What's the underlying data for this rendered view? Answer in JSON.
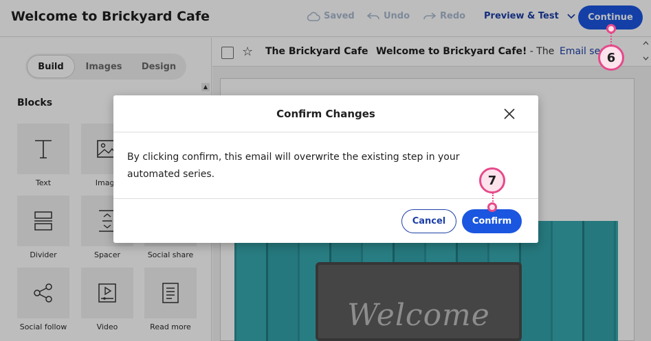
{
  "app": {
    "title": "Welcome to Brickyard Cafe"
  },
  "toolbar": {
    "saved_label": "Saved",
    "undo_label": "Undo",
    "redo_label": "Redo",
    "preview_label": "Preview & Test",
    "continue_label": "Continue",
    "accent": "#1a56e0"
  },
  "left_panel": {
    "tabs": [
      {
        "label": "Build",
        "active": true
      },
      {
        "label": "Images",
        "active": false
      },
      {
        "label": "Design",
        "active": false
      }
    ],
    "blocks_heading": "Blocks",
    "blocks": [
      {
        "label": "Text",
        "icon": "text-icon"
      },
      {
        "label": "Image",
        "icon": "image-icon"
      },
      {
        "label": "Divider",
        "icon": "divider-icon"
      },
      {
        "label": "Spacer",
        "icon": "spacer-icon"
      },
      {
        "label": "Social share",
        "icon": "social-share-icon"
      },
      {
        "label": "Social follow",
        "icon": "social-follow-icon"
      },
      {
        "label": "Video",
        "icon": "video-icon"
      },
      {
        "label": "Read more",
        "icon": "read-more-icon"
      }
    ]
  },
  "email_header": {
    "sender": "The Brickyard Cafe",
    "subject": "Welcome to Brickyard Cafe!",
    "preview": " - The Brickyard Cafe",
    "series_link": "Email series"
  },
  "email_body": {
    "sign_text": "Welcome"
  },
  "dialog": {
    "title": "Confirm Changes",
    "body": "By clicking confirm, this email will overwrite the existing step in your automated series.",
    "cancel_label": "Cancel",
    "confirm_label": "Confirm"
  },
  "callouts": [
    {
      "number": "6"
    },
    {
      "number": "7"
    }
  ]
}
